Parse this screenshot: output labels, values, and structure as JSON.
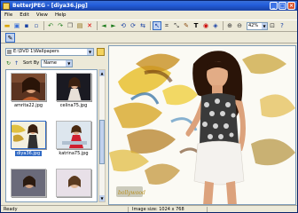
{
  "window": {
    "title": "BetterJPEG - [diya36.jpg]"
  },
  "menu": [
    "File",
    "Edit",
    "View",
    "Help"
  ],
  "toolbar": {
    "zoom": "42%"
  },
  "browser": {
    "path": "E:\\DVD 1\\Wallpapers",
    "sort_label": "Sort By",
    "sort_value": "Name",
    "thumbnails": [
      {
        "file": "amrita22.jpg",
        "selected": false
      },
      {
        "file": "celina75.jpg",
        "selected": false
      },
      {
        "file": "diya36.jpg",
        "selected": true
      },
      {
        "file": "katrina75.jpg",
        "selected": false
      }
    ]
  },
  "viewer": {
    "watermark": "bollywood"
  },
  "status": {
    "ready": "Ready",
    "image_size": "Image size:  1024 x 768"
  },
  "colors": {
    "selection": "#316ac5",
    "titlebar": "#245edb"
  }
}
